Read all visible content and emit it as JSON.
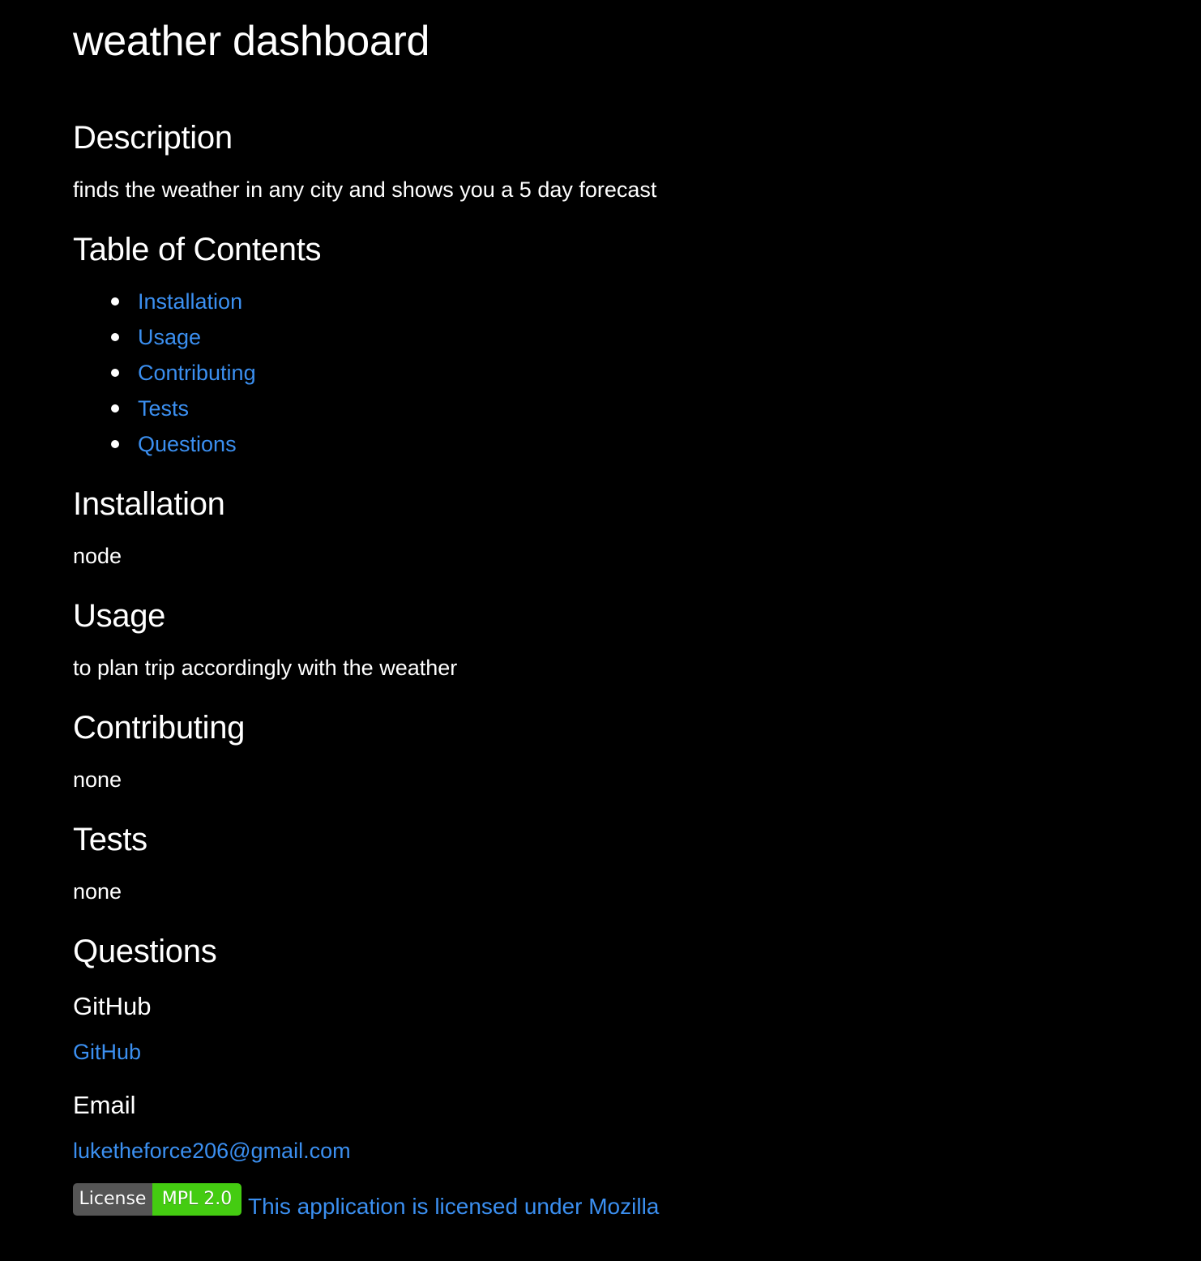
{
  "title": "weather dashboard",
  "description": {
    "heading": "Description",
    "text": "finds the weather in any city and shows you a 5 day forecast"
  },
  "toc": {
    "heading": "Table of Contents",
    "items": [
      {
        "label": "Installation"
      },
      {
        "label": "Usage"
      },
      {
        "label": "Contributing"
      },
      {
        "label": "Tests"
      },
      {
        "label": "Questions"
      }
    ]
  },
  "installation": {
    "heading": "Installation",
    "text": "node"
  },
  "usage": {
    "heading": "Usage",
    "text": "to plan trip accordingly with the weather"
  },
  "contributing": {
    "heading": "Contributing",
    "text": "none"
  },
  "tests": {
    "heading": "Tests",
    "text": "none"
  },
  "questions": {
    "heading": "Questions",
    "github_heading": "GitHub",
    "github_link": "GitHub",
    "email_heading": "Email",
    "email_link": "luketheforce206@gmail.com"
  },
  "license": {
    "badge_label": "License",
    "badge_value": "MPL 2.0",
    "badge_color": "#4c1",
    "link_text": "This application is licensed under Mozilla"
  },
  "colors": {
    "background": "#000000",
    "text": "#ffffff",
    "link": "#3b8ff0"
  }
}
